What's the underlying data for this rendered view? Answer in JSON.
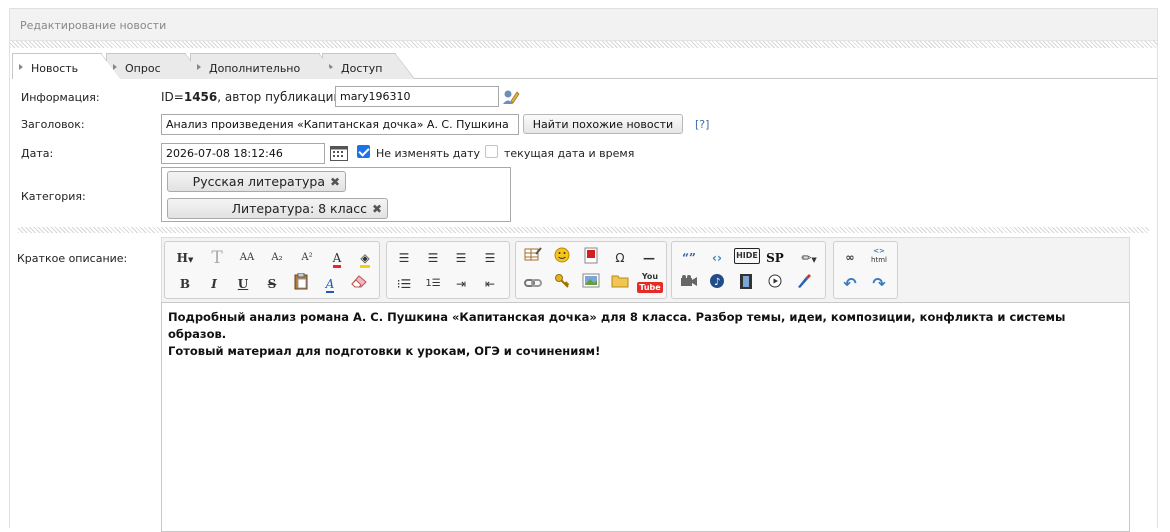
{
  "panel": {
    "title": "Редактирование новости"
  },
  "tabs": [
    {
      "label": "Новость",
      "active": true
    },
    {
      "label": "Опрос",
      "active": false
    },
    {
      "label": "Дополнительно",
      "active": false
    },
    {
      "label": "Доступ",
      "active": false
    }
  ],
  "info": {
    "label": "Информация:",
    "id_prefix": "ID=",
    "id": "1456",
    "author_label": ", автор публикации:",
    "author": "mary196310",
    "edit_icon": "pencil-user-icon"
  },
  "title_field": {
    "label": "Заголовок:",
    "value": "Анализ произведения «Капитанская дочка» А. С. Пушкина",
    "find_button": "Найти похожие новости",
    "help_link": "[?]"
  },
  "date_field": {
    "label": "Дата:",
    "value": "2026-07-08 18:12:46",
    "calendar_icon": "calendar-icon",
    "keep_date_label": "Не изменять дату",
    "keep_date_checked": true,
    "current_date_label": "текущая дата и время",
    "current_date_checked": false
  },
  "category": {
    "label": "Категория:",
    "chips": [
      "Русская литература",
      "Литература: 8 класс"
    ]
  },
  "short_desc": {
    "label": "Краткое описание:",
    "text_line1": "Подробный анализ романа А. С. Пушкина «Капитанская дочка» для 8 класса. Разбор темы, идеи, композиции, конфликта и системы образов.",
    "text_line2": "Готовый материал для подготовки к урокам, ОГЭ и сочинениям!"
  },
  "toolbar": {
    "heading_btn": "H",
    "bold": "B",
    "italic": "I",
    "underline": "U",
    "strike": "S",
    "omega": "Ω",
    "quote": "«»",
    "hide": "HIDE",
    "spoiler": "SP",
    "youtube": "You Tube",
    "html": "html",
    "colors": {
      "accent": "#1a73e8",
      "youtube": "#e52d27",
      "link": "#3a6ea5"
    }
  }
}
